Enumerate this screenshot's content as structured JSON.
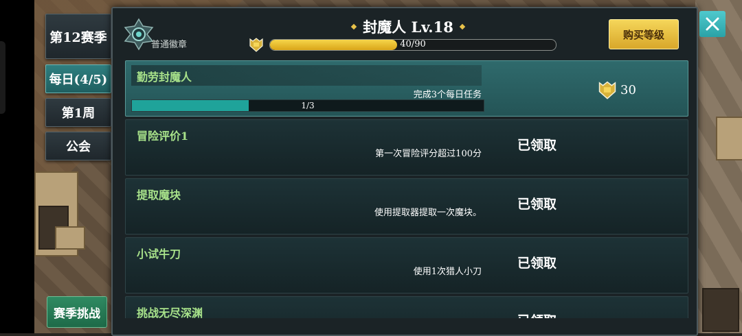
{
  "sidebar": {
    "season": "第12赛季",
    "tabs": [
      {
        "label": "每日(4/5)",
        "active": true
      },
      {
        "label": "第1周",
        "active": false
      },
      {
        "label": "公会",
        "active": false
      }
    ],
    "season_challenge": "赛季挑战"
  },
  "header": {
    "badge_label": "普通徽章",
    "title": "封魔人 Lv.18",
    "xp_text": "40/90",
    "xp_progress": 0.444,
    "buy_label": "购买等级"
  },
  "tasks": [
    {
      "name": "勤劳封魔人",
      "desc": "完成3个每日任务",
      "progress_text": "1/3",
      "progress": 0.333,
      "reward": "30",
      "status": ""
    },
    {
      "name": "冒险评价1",
      "desc": "第一次冒险评分超过100分",
      "status": "已领取"
    },
    {
      "name": "提取魔块",
      "desc": "使用提取器提取一次魔块。",
      "status": "已领取"
    },
    {
      "name": "小试牛刀",
      "desc": "使用1次猎人小刀",
      "status": "已领取"
    },
    {
      "name": "挑战无尽深渊",
      "desc": "",
      "status": "已领取"
    }
  ],
  "colors": {
    "accent": "#2f7f80",
    "gold": "#e8c24a",
    "task_name": "#a8e28a"
  },
  "icons": {
    "badge": "badge-emblem-icon",
    "shield": "shield-icon",
    "close": "close-icon"
  }
}
